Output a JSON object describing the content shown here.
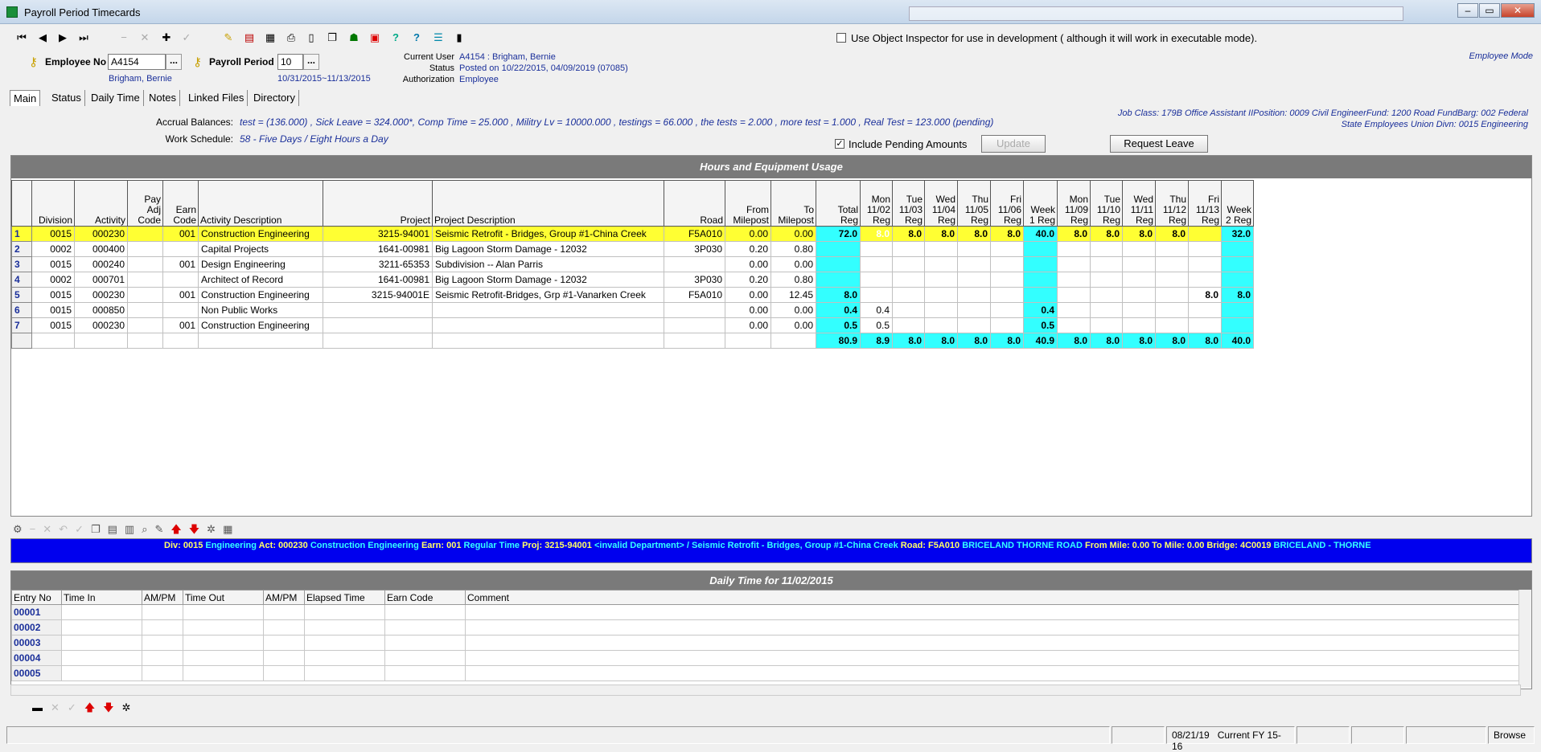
{
  "window": {
    "title": "Payroll Period Timecards",
    "min": "–",
    "max": "▭",
    "close": "✕"
  },
  "toolbar": {
    "inspector_label": "Use Object Inspector for use in development ( although it will work in executable mode)."
  },
  "header": {
    "employee_no_label": "Employee No",
    "employee_no_value": "A4154",
    "employee_name": "Brigham, Bernie",
    "payroll_period_label": "Payroll Period",
    "payroll_period_value": "10",
    "payroll_period_range": "10/31/2015~11/13/2015",
    "current_user_label": "Current User",
    "current_user_value": "A4154 : Brigham, Bernie",
    "status_label": "Status",
    "status_value": "Posted on 10/22/2015, 04/09/2019 (07085)",
    "authorization_label": "Authorization",
    "authorization_value": "Employee",
    "mode": "Employee Mode",
    "dots": "..."
  },
  "tabs": [
    {
      "label": "Main"
    },
    {
      "label": "Status"
    },
    {
      "label": "Daily Time"
    },
    {
      "label": "Notes"
    },
    {
      "label": "Linked Files"
    },
    {
      "label": "Directory"
    }
  ],
  "accrual": {
    "label": "Accrual Balances:",
    "value": "test = (136.000) ,  Sick Leave = 324.000*,  Comp Time = 25.000 ,  Militry Lv = 10000.000 ,  testings = 66.000 ,  the tests = 2.000 ,  more test = 1.000 ,  Real Test = 123.000  (pending)",
    "schedule_label": "Work Schedule:",
    "schedule_value": "58 - Five Days / Eight Hours a Day",
    "include_pending": "Include Pending Amounts",
    "update": "Update",
    "request_leave": "Request Leave",
    "job_line1": "Job Class: 179B Office Assistant IIPosition: 0009 Civil EngineerFund: 1200 Road FundBarg: 002 Federal",
    "job_line2": "State Employees Union  Divn: 0015 Engineering"
  },
  "grid": {
    "title": "Hours and Equipment Usage",
    "headers": [
      "Division",
      "Activity",
      "Pay Adj Code",
      "Earn Code",
      "Activity Description",
      "Project",
      "Project Description",
      "Road",
      "From Milepost",
      "To Milepost",
      "Total Reg",
      "Mon 11/02 Reg",
      "Tue 11/03 Reg",
      "Wed 11/04 Reg",
      "Thu 11/05 Reg",
      "Fri 11/06 Reg",
      "Week 1 Reg",
      "Mon 11/09 Reg",
      "Tue 11/10 Reg",
      "Wed 11/11 Reg",
      "Thu 11/12 Reg",
      "Fri 11/13 Reg",
      "Week 2 Reg"
    ],
    "rows": [
      [
        "1",
        "0015",
        "000230",
        "",
        "001",
        "Construction Engineering",
        "3215-94001",
        "Seismic Retrofit - Bridges, Group #1-China Creek",
        "F5A010",
        "0.00",
        "0.00",
        "72.0",
        "8.0",
        "8.0",
        "8.0",
        "8.0",
        "8.0",
        "40.0",
        "8.0",
        "8.0",
        "8.0",
        "8.0",
        "",
        "32.0"
      ],
      [
        "2",
        "0002",
        "000400",
        "",
        "",
        "Capital Projects",
        "1641-00981",
        "Big Lagoon Storm Damage - 12032",
        "3P030",
        "0.20",
        "0.80",
        "",
        "",
        "",
        "",
        "",
        "",
        "",
        "",
        "",
        "",
        "",
        "",
        ""
      ],
      [
        "3",
        "0015",
        "000240",
        "",
        "001",
        "Design Engineering",
        "3211-65353",
        "Subdivision -- Alan Parris",
        "",
        "0.00",
        "0.00",
        "",
        "",
        "",
        "",
        "",
        "",
        "",
        "",
        "",
        "",
        "",
        "",
        ""
      ],
      [
        "4",
        "0002",
        "000701",
        "",
        "",
        "Architect of Record",
        "1641-00981",
        "Big Lagoon Storm Damage - 12032",
        "3P030",
        "0.20",
        "0.80",
        "",
        "",
        "",
        "",
        "",
        "",
        "",
        "",
        "",
        "",
        "",
        "",
        ""
      ],
      [
        "5",
        "0015",
        "000230",
        "",
        "001",
        "Construction Engineering",
        "3215-94001E",
        "Seismic Retrofit-Bridges, Grp #1-Vanarken Creek",
        "F5A010",
        "0.00",
        "12.45",
        "8.0",
        "",
        "",
        "",
        "",
        "",
        "",
        "",
        "",
        "",
        "",
        "8.0",
        "8.0"
      ],
      [
        "6",
        "0015",
        "000850",
        "",
        "",
        "Non Public Works",
        "",
        "",
        "",
        "0.00",
        "0.00",
        "0.4",
        "0.4",
        "",
        "",
        "",
        "",
        "0.4",
        "",
        "",
        "",
        "",
        "",
        ""
      ],
      [
        "7",
        "0015",
        "000230",
        "",
        "001",
        "Construction Engineering",
        "",
        "",
        "",
        "0.00",
        "0.00",
        "0.5",
        "0.5",
        "",
        "",
        "",
        "",
        "0.5",
        "",
        "",
        "",
        "",
        "",
        ""
      ]
    ],
    "totals": [
      "80.9",
      "8.9",
      "8.0",
      "8.0",
      "8.0",
      "8.0",
      "40.9",
      "8.0",
      "8.0",
      "8.0",
      "8.0",
      "8.0",
      "40.0"
    ]
  },
  "infobar": [
    {
      "k": "Div: 0015 ",
      "v": "Engineering "
    },
    {
      "k": "Act: 000230 ",
      "v": "Construction Engineering "
    },
    {
      "k": "Earn: 001 ",
      "v": "Regular Time "
    },
    {
      "k": "Proj: 3215-94001 ",
      "v": "<invalid Department> / Seismic Retrofit - Bridges, Group #1-China Creek "
    },
    {
      "k": "Road: F5A010 ",
      "v": "BRICELAND THORNE ROAD "
    },
    {
      "k": "From Mile: 0.00  To Mile: 0.00  Bridge: 4C0019 ",
      "v": "BRICELAND - THORNE"
    }
  ],
  "daily": {
    "title": "Daily Time for 11/02/2015",
    "headers": [
      "Entry No",
      "Time In",
      "AM/PM",
      "Time Out",
      "AM/PM",
      "Elapsed Time",
      "Earn Code",
      "Comment"
    ],
    "entries": [
      "00001",
      "00002",
      "00003",
      "00004",
      "00005"
    ]
  },
  "statusbar": {
    "date": "08/21/19",
    "fy": "Current FY 15-16",
    "mode": "Browse"
  }
}
